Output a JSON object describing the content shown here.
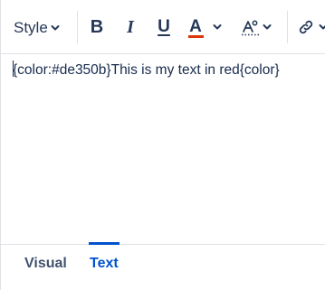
{
  "toolbar": {
    "style_label": "Style",
    "bold_label": "B",
    "italic_label": "I",
    "underline_label": "U",
    "text_color_label": "A",
    "text_color_swatch": "#de350b",
    "icons": [
      "chevron-down-icon",
      "more-formatting-icon",
      "link-icon"
    ]
  },
  "editor": {
    "content": "{color:#de350b}This is my text in red{color}"
  },
  "tabs": [
    {
      "label": "Visual",
      "active": false
    },
    {
      "label": "Text",
      "active": true
    }
  ],
  "colors": {
    "accent": "#0052cc",
    "text": "#172b4d",
    "red": "#de350b"
  }
}
